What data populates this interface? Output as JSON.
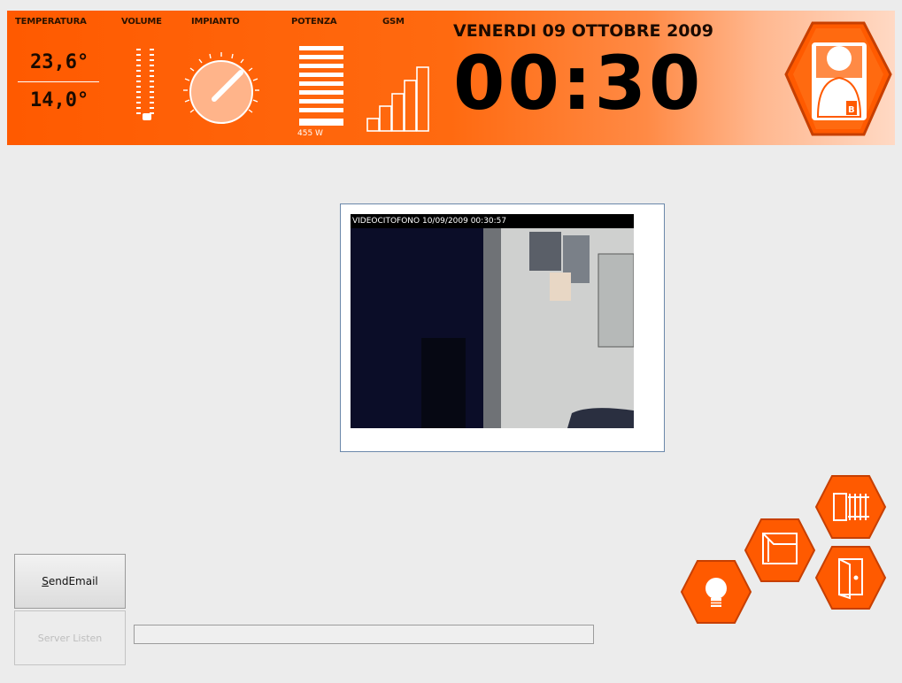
{
  "header": {
    "labels": {
      "temperature": "TEMPERATURA",
      "volume": "VOLUME",
      "system": "IMPIANTO",
      "power": "POTENZA",
      "gsm": "GSM"
    },
    "temp_inside": "23,6°",
    "temp_outside": "14,0°",
    "power_value": "455 W",
    "date": "VENERDI 09 OTTOBRE 2009",
    "clock": "00:30"
  },
  "video": {
    "overlay": "VIDEOCITOFONO 10/09/2009 00:30:57"
  },
  "actions": {
    "send_email_prefix": "S",
    "send_email_rest": "endEmail",
    "server_listen": "Server Listen"
  },
  "progress": {
    "value": 0
  },
  "colors": {
    "accent": "#ff5a00",
    "hex_button": "#ff5a00",
    "background": "#ececec"
  },
  "icons": [
    "thermometer-slider-icon",
    "dial-icon",
    "power-bars-icon",
    "gsm-signal-icon",
    "user-badge-icon",
    "bulb-icon",
    "window-icon",
    "gate-icon",
    "door-icon"
  ]
}
